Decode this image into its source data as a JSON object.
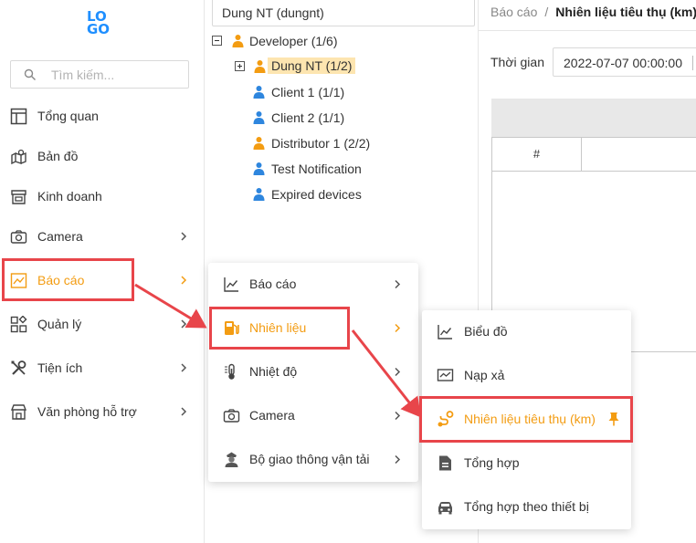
{
  "logo": {
    "line1": "LO",
    "line2": "GO"
  },
  "search": {
    "placeholder": "Tìm kiếm..."
  },
  "sidebar": {
    "items": [
      {
        "label": "Tổng quan",
        "icon": "dashboard-icon"
      },
      {
        "label": "Bản đồ",
        "icon": "map-icon"
      },
      {
        "label": "Kinh doanh",
        "icon": "store-icon"
      },
      {
        "label": "Camera",
        "icon": "camera-icon"
      },
      {
        "label": "Báo cáo",
        "icon": "chart-line-icon"
      },
      {
        "label": "Quản lý",
        "icon": "grid-icon"
      },
      {
        "label": "Tiện ích",
        "icon": "tools-icon"
      },
      {
        "label": "Văn phòng hỗ trợ",
        "icon": "shop-icon"
      }
    ]
  },
  "tree": {
    "user": "Dung NT (dungnt)",
    "nodes": [
      {
        "label": "Developer (1/6)",
        "type": "group"
      },
      {
        "label": "Dung NT (1/2)",
        "type": "group",
        "selected": true
      },
      {
        "label": "Client 1 (1/1)",
        "type": "user"
      },
      {
        "label": "Client 2 (1/1)",
        "type": "user"
      },
      {
        "label": "Distributor 1 (2/2)",
        "type": "group"
      },
      {
        "label": "Test Notification",
        "type": "user"
      },
      {
        "label": "Expired devices",
        "type": "user"
      }
    ]
  },
  "main": {
    "breadcrumb": {
      "parent": "Báo cáo",
      "separator": "/",
      "current": "Nhiên liệu tiêu thụ (km)"
    },
    "time_label": "Thời gian",
    "time_value": "2022-07-07 00:00:00",
    "table_col_hash": "#"
  },
  "submenu1": {
    "items": [
      {
        "label": "Báo cáo",
        "icon": "chart-line-icon"
      },
      {
        "label": "Nhiên liệu",
        "icon": "fuel-pump-icon"
      },
      {
        "label": "Nhiệt độ",
        "icon": "thermometer-icon"
      },
      {
        "label": "Camera",
        "icon": "camera-icon"
      },
      {
        "label": "Bộ giao thông vận tải",
        "icon": "police-officer-icon"
      }
    ]
  },
  "submenu2": {
    "items": [
      {
        "label": "Biểu đồ",
        "icon": "chart-line-icon"
      },
      {
        "label": "Nạp xả",
        "icon": "monitor-chart-icon"
      },
      {
        "label": "Nhiên liệu tiêu thụ (km)",
        "icon": "route-icon"
      },
      {
        "label": "Tổng hợp",
        "icon": "document-icon"
      },
      {
        "label": "Tổng hợp theo thiết bị",
        "icon": "car-icon"
      }
    ]
  },
  "colors": {
    "accent": "#f39c12",
    "brand": "#1f8fff",
    "annotation": "#e8454a",
    "user_blue": "#2e86de",
    "user_orange": "#f39c12"
  }
}
